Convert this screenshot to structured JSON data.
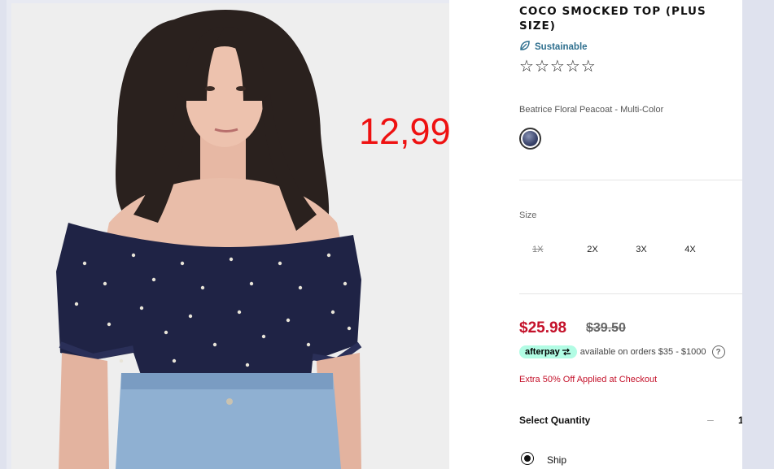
{
  "overlay": {
    "price": "12,99"
  },
  "product": {
    "title": "COCO SMOCKED TOP (PLUS SIZE)",
    "badge": "Sustainable",
    "rating_stars": 5,
    "rating_value": 0,
    "color_name": "Beatrice Floral Peacoat - Multi-Color"
  },
  "size": {
    "label": "Size",
    "options": [
      {
        "label": "1X",
        "available": false
      },
      {
        "label": "2X",
        "available": true
      },
      {
        "label": "3X",
        "available": true
      },
      {
        "label": "4X",
        "available": true
      }
    ]
  },
  "pricing": {
    "sale_price": "$25.98",
    "original_price": "$39.50",
    "afterpay_brand": "afterpay",
    "afterpay_text": "available on orders $35 - $1000",
    "promo": "Extra 50% Off Applied at Checkout"
  },
  "quantity": {
    "label": "Select Quantity",
    "minus": "–",
    "value": "1"
  },
  "delivery": {
    "option": "Ship",
    "selected": true
  },
  "colors": {
    "sale": "#c4112a",
    "sustain": "#2e6f8e",
    "afterpay_bg": "#b2fce4",
    "overlay": "#ee1111"
  }
}
